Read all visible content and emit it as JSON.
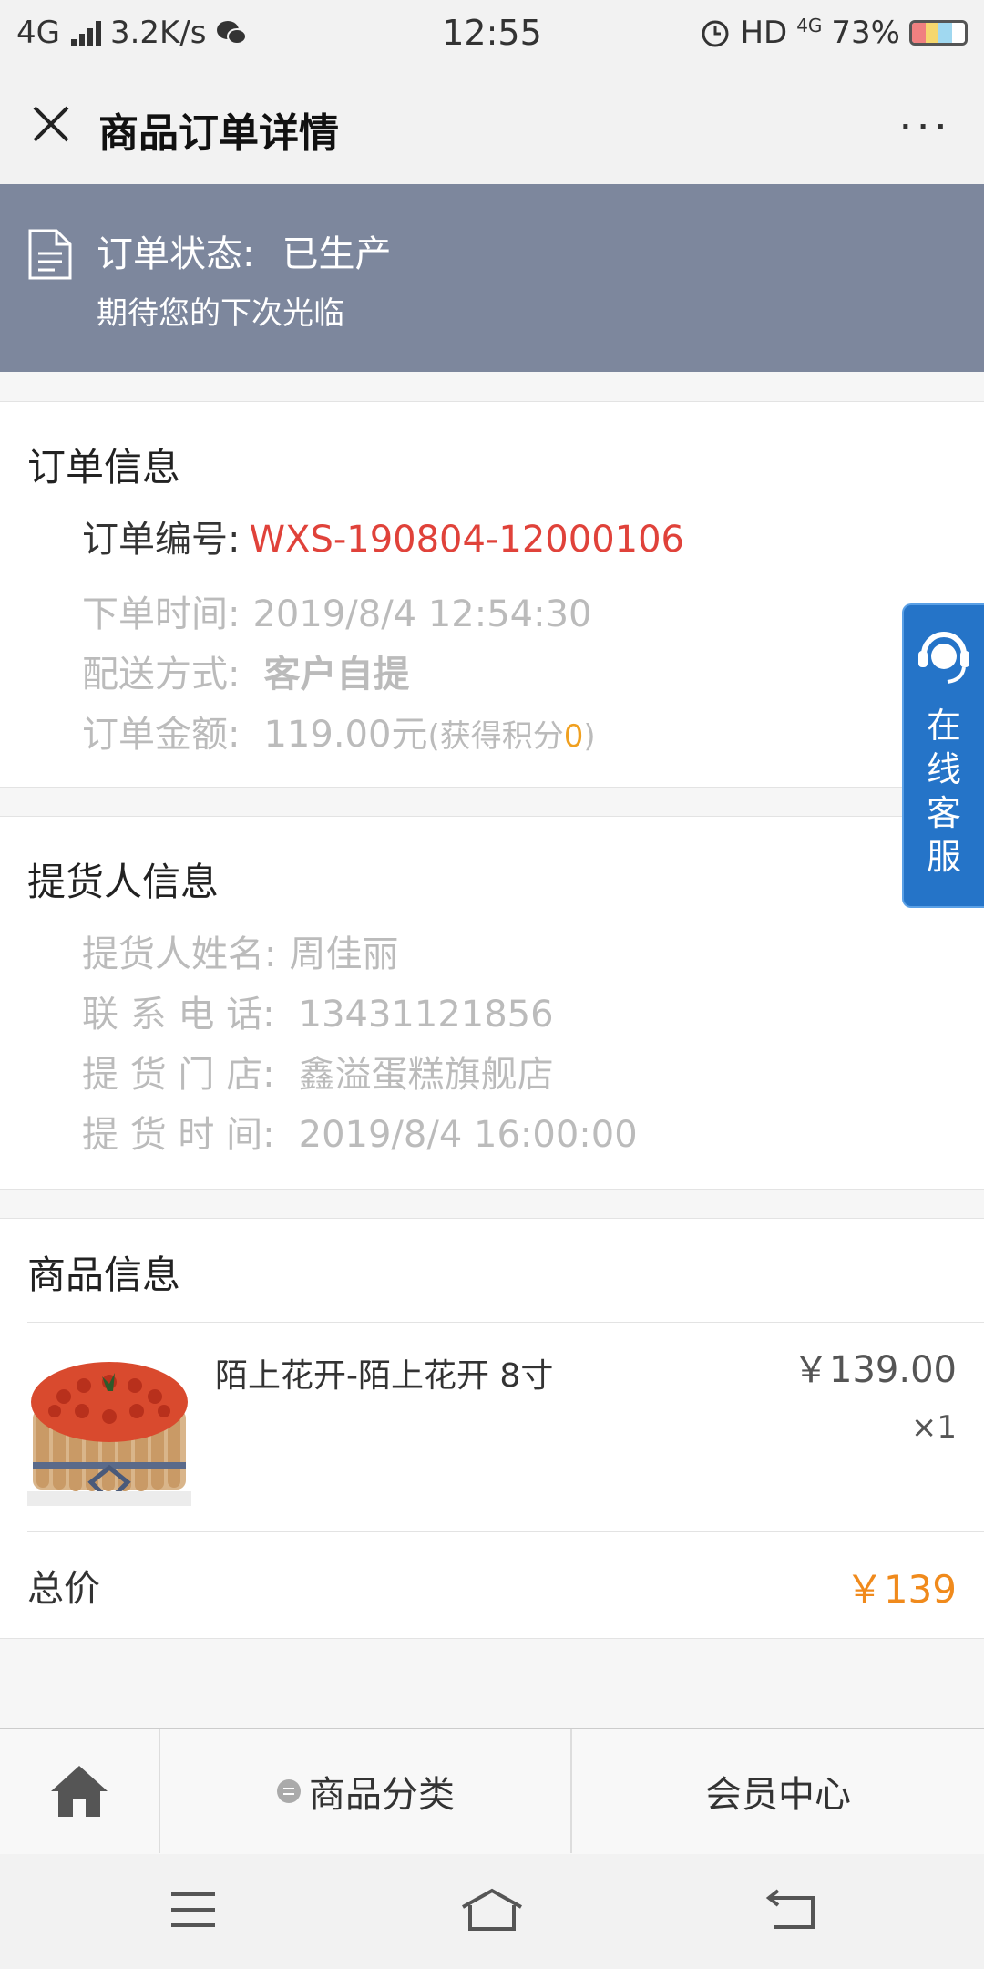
{
  "status_bar": {
    "network": "4G",
    "speed": "3.2K/s",
    "time": "12:55",
    "hd": "HD",
    "net2": "4G",
    "battery": "73%"
  },
  "header": {
    "title": "商品订单详情",
    "more": "···"
  },
  "banner": {
    "status_label": "订单状态:",
    "status_value": "已生产",
    "subtitle": "期待您的下次光临",
    "bg_color": "#7d879d"
  },
  "order_info": {
    "heading": "订单信息",
    "number_label": "订单编号:",
    "number_value": "WXS-190804-12000106",
    "time_label": "下单时间:",
    "time_value": "2019/8/4 12:54:30",
    "delivery_label": "配送方式:",
    "delivery_value": "客户自提",
    "amount_label": "订单金额:",
    "amount_value": "119.00元",
    "points_prefix": "(获得积分",
    "points_value": "0",
    "points_suffix": ")"
  },
  "pickup_info": {
    "heading": "提货人信息",
    "name_label": "提货人姓名:",
    "name_value": "周佳丽",
    "phone_label": "联 系 电 话:",
    "phone_value": "13431121856",
    "store_label": "提 货 门 店:",
    "store_value": "鑫溢蛋糕旗舰店",
    "time_label": "提 货 时 间:",
    "time_value": "2019/8/4 16:00:00"
  },
  "product_info": {
    "heading": "商品信息",
    "items": [
      {
        "name": "陌上花开-陌上花开 8寸",
        "price": "￥139.00",
        "qty": "×1"
      }
    ],
    "total_label": "总价",
    "total_value": "￥139"
  },
  "service_button": {
    "label": "在线客服",
    "color": "#2574c8"
  },
  "tabbar": {
    "category": "商品分类",
    "member": "会员中心"
  }
}
